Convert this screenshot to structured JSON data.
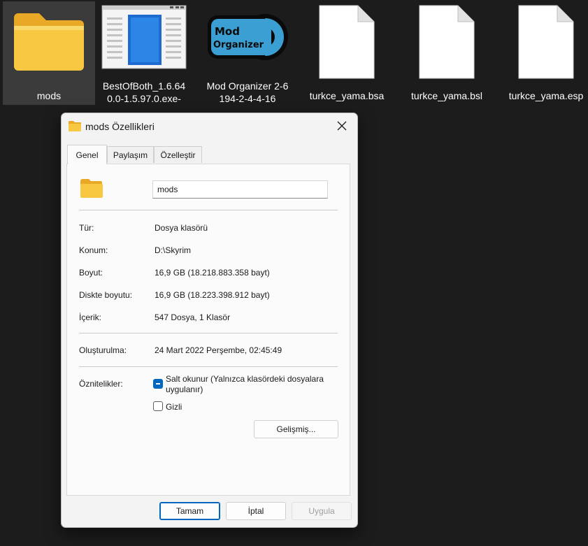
{
  "desktop": {
    "icons": [
      {
        "label": "mods"
      },
      {
        "label": "BestOfBoth_1.6.640.0-1.5.97.0.exe-"
      },
      {
        "label": "Mod Organizer 2-6194-2-4-4-16"
      },
      {
        "label": "turkce_yama.bsa"
      },
      {
        "label": "turkce_yama.bsl"
      },
      {
        "label": "turkce_yama.esp"
      }
    ],
    "mod_organizer_logo_text": [
      "Mod",
      "Organizer"
    ]
  },
  "dialog": {
    "title": "mods Özellikleri",
    "tabs": [
      "Genel",
      "Paylaşım",
      "Özelleştir"
    ],
    "active_tab": "Genel",
    "name_value": "mods",
    "rows": [
      {
        "label": "Tür:",
        "value": "Dosya klasörü"
      },
      {
        "label": "Konum:",
        "value": "D:\\Skyrim"
      },
      {
        "label": "Boyut:",
        "value": "16,9 GB (18.218.883.358 bayt)"
      },
      {
        "label": "Diskte boyutu:",
        "value": "16,9 GB (18.223.398.912 bayt)"
      },
      {
        "label": "İçerik:",
        "value": "547 Dosya, 1 Klasör"
      }
    ],
    "created": {
      "label": "Oluşturulma:",
      "value": "24 Mart 2022 Perşembe, 02:45:49"
    },
    "attributes": {
      "label": "Öznitelikler:",
      "readonly": "Salt okunur (Yalnızca klasördeki dosyalara uygulanır)",
      "readonly_state": "indeterminate",
      "hidden": "Gizli",
      "hidden_state": "unchecked",
      "advanced": "Gelişmiş..."
    },
    "buttons": {
      "ok": "Tamam",
      "cancel": "İptal",
      "apply": "Uygula"
    }
  },
  "colors": {
    "accent": "#0067c0",
    "folder": "#f7c545",
    "desktop_bg": "#1c1c1c"
  }
}
